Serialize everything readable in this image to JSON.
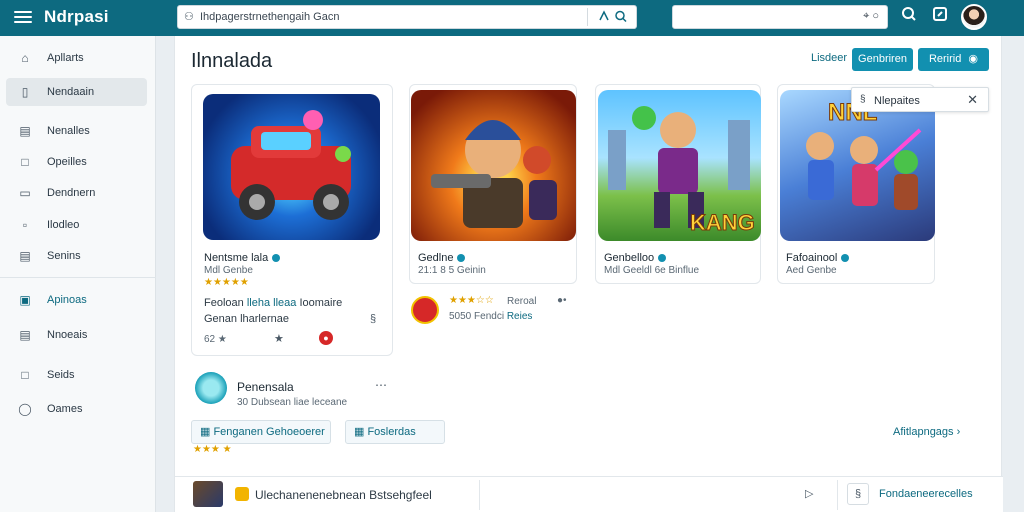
{
  "app": {
    "brand": "Ndrpasi"
  },
  "search": {
    "value": "Ihdpagerstrnethengaih Gacn"
  },
  "sidebar": {
    "items": [
      {
        "label": "Apllarts",
        "icon": "home-icon"
      },
      {
        "label": "Nendaain",
        "icon": "file-icon"
      },
      {
        "label": "Nenalles",
        "icon": "document-icon"
      },
      {
        "label": "Opeilles",
        "icon": "chat-icon"
      },
      {
        "label": "Dendnern",
        "icon": "folder-icon"
      },
      {
        "label": "Ilodleo",
        "icon": "bookmark-icon"
      },
      {
        "label": "Senins",
        "icon": "document-icon"
      },
      {
        "label": "Apinoas",
        "icon": "store-icon"
      },
      {
        "label": "Nnoeais",
        "icon": "document-icon"
      },
      {
        "label": "Seids",
        "icon": "flag-icon"
      },
      {
        "label": "Oames",
        "icon": "help-icon"
      }
    ]
  },
  "main": {
    "title": "Ilnnalada",
    "link_label": "Lisdeer",
    "button_1": "Genbriren",
    "button_2": "Reririd",
    "popup": {
      "text": "Nlepaites"
    }
  },
  "cards": [
    {
      "title": "Nentsme lala",
      "sub": "Mdl Genbe",
      "stars": "★★★★★"
    },
    {
      "title": "Gedlne",
      "sub": "21:1 8 5 Geinin",
      "stars": ""
    },
    {
      "title": "Genbelloo",
      "sub": "Mdl Geeldl 6e Binflue",
      "stars": ""
    },
    {
      "title": "Fafoainool",
      "sub": "Aed Genbe",
      "stars": ""
    }
  ],
  "details": {
    "desc_line1_a": "Feoloan",
    "desc_line1_b": "lleha lleaa",
    "desc_line1_c": "Ioomaire",
    "desc_line2": "Genan lharlernae",
    "meta_a": "62 ★",
    "card2_stars": "★★★☆☆",
    "card2_label": "Reroal",
    "card2_meta_a": "5050 Fendci",
    "card2_meta_b": "Reies"
  },
  "profile": {
    "name": "Penensala",
    "sub": "30 Dubsean liae leceane"
  },
  "chips": {
    "chip_1": "Fenganen Gehoeoerer",
    "chip_2": "Foslerdas",
    "link": "Afitlapngags"
  },
  "bottom": {
    "text": "Ulechanenenebnean Bstsehgfeel",
    "action": "Fondaeneerecelles"
  },
  "colors": {
    "topbar": "#0d6a80",
    "accent": "#1290b0",
    "star": "#e0a100",
    "badge_red": "#d62828"
  }
}
